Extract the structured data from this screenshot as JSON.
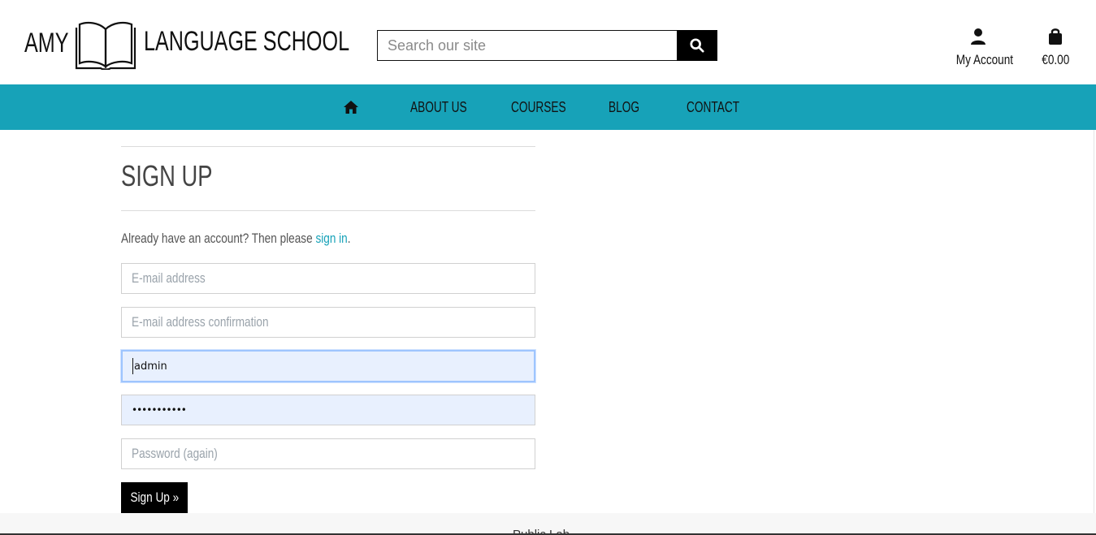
{
  "brand": {
    "word1": "AMY",
    "word2": "LANGUAGE SCHOOL",
    "book_icon": "open-book-icon"
  },
  "search": {
    "placeholder": "Search our site",
    "icon": "search-icon"
  },
  "header": {
    "account_label": "My Account",
    "account_icon": "user-icon",
    "cart_total": "€0.00",
    "cart_icon": "shopping-bag-icon"
  },
  "nav": {
    "home_icon": "home-icon",
    "items": [
      {
        "label": "ABOUT US"
      },
      {
        "label": "COURSES"
      },
      {
        "label": "BLOG"
      },
      {
        "label": "CONTACT"
      }
    ]
  },
  "signup": {
    "title": "SIGN UP",
    "prompt_prefix": "Already have an account? Then please ",
    "signin_link": "sign in",
    "prompt_suffix": ".",
    "fields": {
      "email": {
        "placeholder": "E-mail address",
        "value": ""
      },
      "email_confirm": {
        "placeholder": "E-mail address confirmation",
        "value": ""
      },
      "username": {
        "value": "admin"
      },
      "password": {
        "value": "•••••••••••"
      },
      "password_again": {
        "placeholder": "Password (again)",
        "value": ""
      }
    },
    "submit_label": "Sign Up »"
  },
  "footer": {
    "text": "Public Lab…"
  },
  "colors": {
    "accent": "#17a2b8",
    "autofill": "#e8f0fe",
    "button": "#000000"
  }
}
